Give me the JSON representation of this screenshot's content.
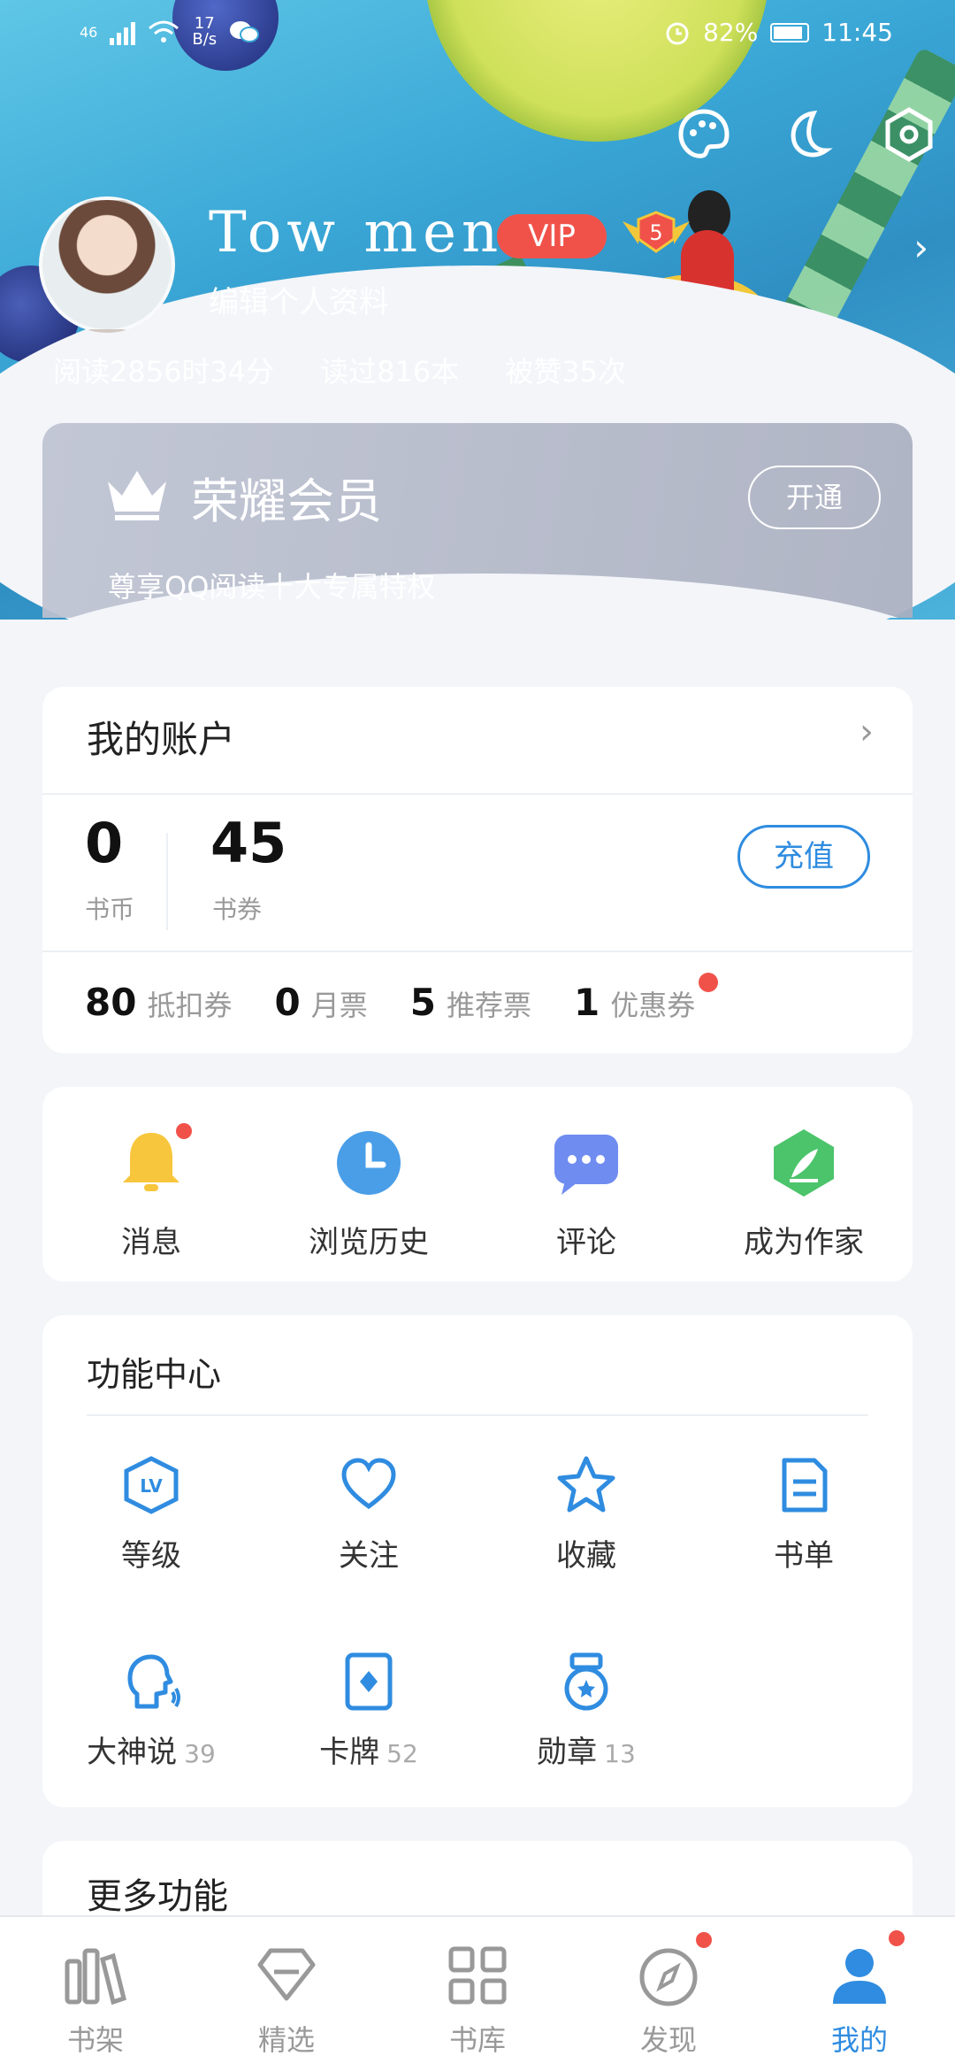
{
  "status_bar": {
    "network": "46",
    "net_speed_value": "17",
    "net_speed_unit": "B/s",
    "battery": "82%",
    "time": "11:45"
  },
  "profile": {
    "username": "Tow men.",
    "vip_label": "VIP",
    "level": "5",
    "edit_label": "编辑个人资料",
    "stats": {
      "reading_time": "阅读2856时34分",
      "books_read": "读过816本",
      "likes": "被赞35次"
    }
  },
  "vip_card": {
    "title": "荣耀会员",
    "subtitle": "尊享QQ阅读十大专属特权",
    "open_label": "开通"
  },
  "account": {
    "title": "我的账户",
    "coins_value": "0",
    "coins_label": "书币",
    "vouchers_value": "45",
    "vouchers_label": "书券",
    "recharge_label": "充值",
    "tickets": [
      {
        "value": "80",
        "label": "抵扣券"
      },
      {
        "value": "0",
        "label": "月票"
      },
      {
        "value": "5",
        "label": "推荐票"
      },
      {
        "value": "1",
        "label": "优惠券"
      }
    ]
  },
  "quick_actions": [
    {
      "label": "消息",
      "icon": "bell-icon"
    },
    {
      "label": "浏览历史",
      "icon": "clock-icon"
    },
    {
      "label": "评论",
      "icon": "comment-icon"
    },
    {
      "label": "成为作家",
      "icon": "pen-icon"
    }
  ],
  "function_center": {
    "title": "功能中心",
    "items": [
      {
        "label": "等级",
        "count": "",
        "icon": "level-icon"
      },
      {
        "label": "关注",
        "count": "",
        "icon": "heart-icon"
      },
      {
        "label": "收藏",
        "count": "",
        "icon": "star-icon"
      },
      {
        "label": "书单",
        "count": "",
        "icon": "booklist-icon"
      },
      {
        "label": "大神说",
        "count": "39",
        "icon": "talk-icon"
      },
      {
        "label": "卡牌",
        "count": "52",
        "icon": "card-icon"
      },
      {
        "label": "勋章",
        "count": "13",
        "icon": "medal-icon"
      }
    ]
  },
  "more": {
    "title": "更多功能"
  },
  "tabbar": [
    {
      "label": "书架",
      "icon": "bookshelf-icon"
    },
    {
      "label": "精选",
      "icon": "diamond-icon"
    },
    {
      "label": "书库",
      "icon": "grid-icon"
    },
    {
      "label": "发现",
      "icon": "compass-icon"
    },
    {
      "label": "我的",
      "icon": "user-icon"
    }
  ],
  "colors": {
    "accent": "#2f8ce0",
    "badge_red": "#f0524a",
    "vip_red": "#f0524a"
  }
}
